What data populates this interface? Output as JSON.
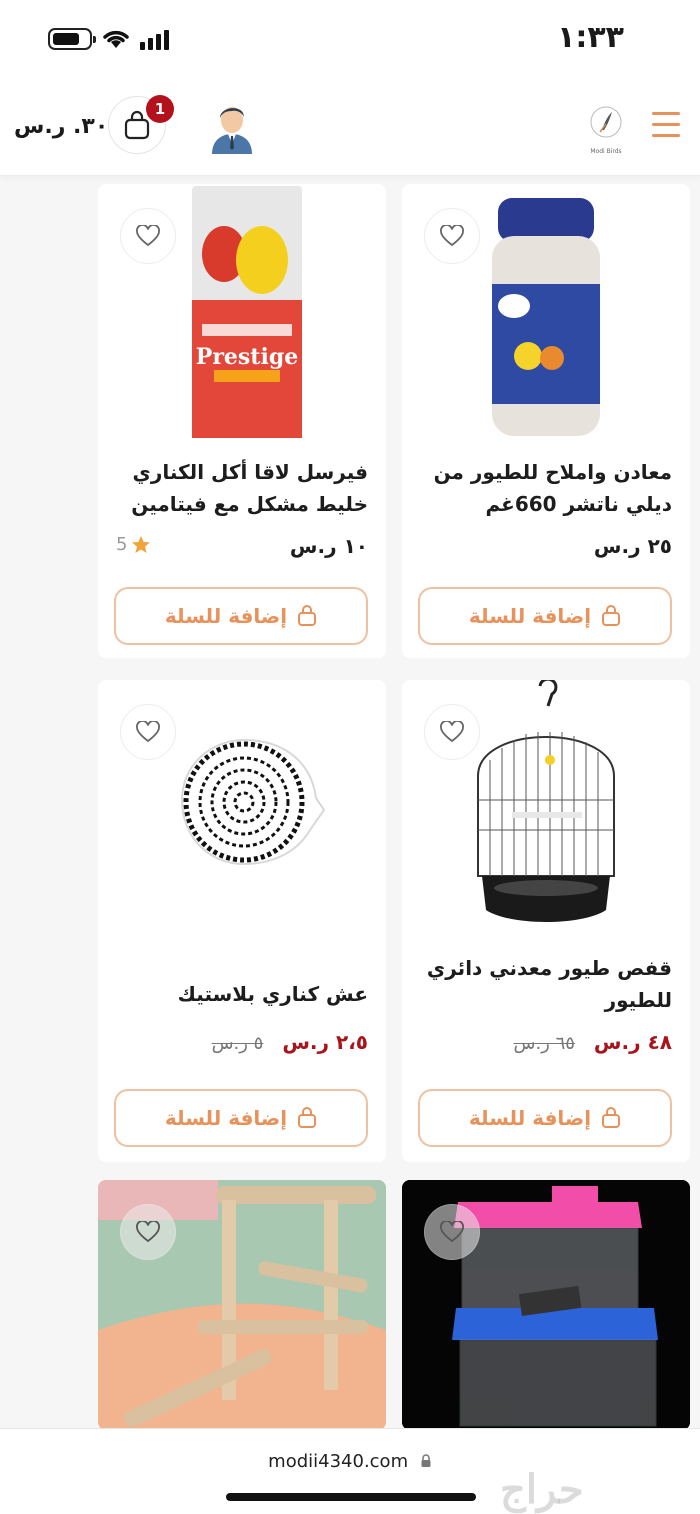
{
  "status_bar": {
    "time": "١:٣٣"
  },
  "header": {
    "cart_total": "٣٠. ر.س",
    "cart_count": "1",
    "logo_text": "Modi Birds"
  },
  "products": [
    {
      "title": "معادن واملاح للطيور من ديلي ناتشر 660غم",
      "price": "٢٥ ر.س",
      "add_label": "إضافة للسلة",
      "image": "mineral-jar"
    },
    {
      "title": "فيرسل لاقا أكل الكناري خليط مشكل مع فيتامين",
      "price": "١٠ ر.س",
      "rating": "5",
      "add_label": "إضافة للسلة",
      "image": "prestige-canaries-bag"
    },
    {
      "title": "قفص طيور معدني دائري للطيور",
      "price": "٤٨ ر.س",
      "old_price": "٦٥ ر.س",
      "add_label": "إضافة للسلة",
      "image": "round-bird-cage"
    },
    {
      "title": "عش كناري بلاستيك",
      "price": "٢،٥ ر.س",
      "old_price": "٥ ر.س",
      "add_label": "إضافة للسلة",
      "image": "plastic-canary-nest"
    },
    {
      "image": "plastic-travel-cages"
    },
    {
      "image": "wooden-perch-stand"
    }
  ],
  "url_bar": {
    "url": "modii4340.com"
  },
  "watermark": "حراج",
  "colors": {
    "accent": "#e8925b",
    "sale": "#a8141c",
    "badge": "#b3121c"
  }
}
